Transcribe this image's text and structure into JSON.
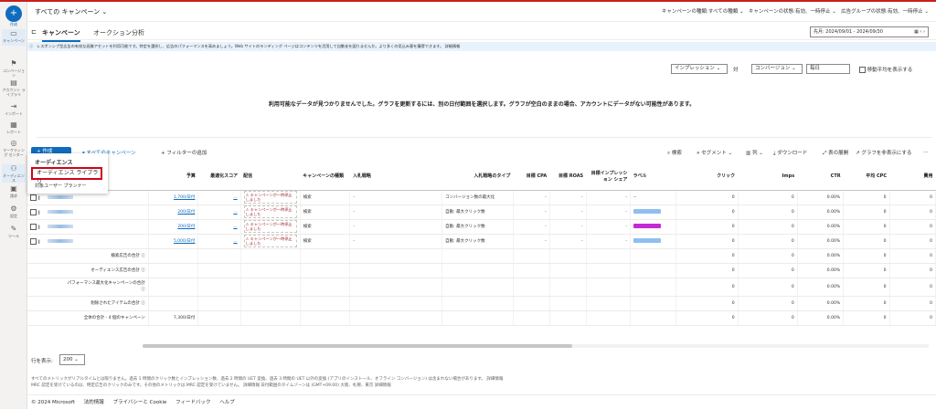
{
  "header": {
    "campaign_selector": "すべての キャンペーン",
    "filters": [
      "キャンペーンの種類:すべての種類",
      "キャンペーンの状態:有効、一時停止",
      "広告グループの状態:有効、一時停止"
    ]
  },
  "rail": {
    "create": "作成",
    "items": [
      "キャンペーン",
      "コンバージョン",
      "アカウント\nライブラリ",
      "インポート",
      "レポート",
      "マーケティング\nセンター",
      "オーディエンス",
      "請求",
      "設定",
      "ツール"
    ]
  },
  "tabs": {
    "items": [
      "キャンペーン",
      "オークション分析"
    ],
    "date_range": "先月: 2024/09/01 - 2024/09/30"
  },
  "info_banner": "レスポンシブ型広告の有効な画像アセットを利用可能です。特定を選択し、広告のパフォーマンスを高めましょう。Web サイトのランディング ページはコンテンツを活用して自動化を図りませんか。より多くの見込み客を獲得できます。  詳細情報",
  "chart_controls": {
    "metric1": "インプレッション",
    "vs": "対",
    "metric2": "コンバージョン",
    "period": "毎日",
    "moving_avg": "移動平均を表示する"
  },
  "no_data_msg": "利用可能なデータが見つかりませんでした。グラフを更新するには、別の日付範囲を選択します。グラフが空白のままの場合、アカウントにデータがない可能性があります。",
  "toolbar": {
    "add": "+ 作成",
    "all_campaigns": "すべてのキャンペーン",
    "add_filter": "+ フィルターの追加",
    "search": "検索",
    "segment": "セグメント",
    "columns": "列",
    "download": "ダウンロード",
    "expand": "表の展開",
    "hide_chart": "グラフを非表示にする"
  },
  "popup": {
    "heading": "オーディエンス",
    "library": "オーディエンス ライブラリ",
    "planner": "対象ユーザー プランナー"
  },
  "table": {
    "columns": [
      "予算",
      "最適化スコア",
      "配信",
      "キャンペーンの種類",
      "入札戦略",
      "入札戦略のタイプ",
      "目標 CPA",
      "目標 ROAS",
      "目標インプレッション シェア",
      "ラベル",
      "クリック",
      "Imps",
      "CTR",
      "平均 CPC",
      "費用"
    ],
    "rows": [
      {
        "budget": "1,700/日付",
        "score": "...",
        "delivery": "キャンペーンが一時停止しました",
        "type": "検索",
        "bid": "-",
        "bidtype": "コンバージョン数の最大化",
        "cpa": "-",
        "roas": "-",
        "share": "-",
        "label": "--",
        "clicks": "0",
        "imps": "0",
        "ctr": "0.00%",
        "cpc": "0",
        "cost": "0"
      },
      {
        "budget": "200/日付",
        "score": "...",
        "delivery": "キャンペーンが一時停止しました",
        "type": "検索",
        "bid": "-",
        "bidtype": "自動: 最大クリック数",
        "cpa": "-",
        "roas": "-",
        "share": "-",
        "label": "",
        "clicks": "0",
        "imps": "0",
        "ctr": "0.00%",
        "cpc": "0",
        "cost": "0"
      },
      {
        "budget": "200/日付",
        "score": "...",
        "delivery": "キャンペーンが一時停止しました",
        "type": "検索",
        "bid": "-",
        "bidtype": "自動: 最大クリック数",
        "cpa": "-",
        "roas": "-",
        "share": "-",
        "label": "",
        "clicks": "0",
        "imps": "0",
        "ctr": "0.00%",
        "cpc": "0",
        "cost": "0"
      },
      {
        "budget": "5,000/日付",
        "score": "...",
        "delivery": "キャンペーンが一時停止しました",
        "type": "検索",
        "bid": "-",
        "bidtype": "自動: 最大クリック数",
        "cpa": "-",
        "roas": "-",
        "share": "-",
        "label": "",
        "clicks": "0",
        "imps": "0",
        "ctr": "0.00%",
        "cpc": "0",
        "cost": "0"
      }
    ],
    "label_colors": [
      "#8fbfee",
      "#c42bd3",
      "#8fbfee"
    ],
    "totals": [
      {
        "label": "検索広告の合計",
        "budget": "",
        "clicks": "0",
        "imps": "0",
        "ctr": "0.00%",
        "cpc": "0",
        "cost": "0"
      },
      {
        "label": "オーディエンス広告の合計",
        "budget": "",
        "clicks": "0",
        "imps": "0",
        "ctr": "0.00%",
        "cpc": "0",
        "cost": "0"
      },
      {
        "label": "パフォーマンス最大化キャンペーンの合計",
        "budget": "",
        "clicks": "0",
        "imps": "0",
        "ctr": "0.00%",
        "cpc": "0",
        "cost": "0"
      },
      {
        "label": "削除されたアイテムの合計",
        "budget": "",
        "clicks": "0",
        "imps": "0",
        "ctr": "0.00%",
        "cpc": "0",
        "cost": "0"
      },
      {
        "label": "全体の合計 - 4 個のキャンペーン",
        "budget": "7,300/日付",
        "clicks": "0",
        "imps": "0",
        "ctr": "0.00%",
        "cpc": "0",
        "cost": "0"
      }
    ]
  },
  "pager": {
    "rows_label": "行を表示:",
    "rows_value": "200"
  },
  "footnote": "すべてのメトリックがリアルタイムとは限りません。過去 1 時間のクリック数とインプレッション数、過去 2 時間の UET 変換、過去 3 時間の UET 以外の変換 (アプリのインストール、オフライン コンバージョン) は含まれない場合があります。 詳細情報\nMRC 認定を受けているのは、特定広告のクリックのみです。その他のメトリックは MRC 認定を受けていません。 詳細情報   日付範囲のタイムゾーンは (GMT+09:00) 大阪、札幌、東京 詳細情報",
  "footer": [
    "© 2024 Microsoft",
    "法的情報",
    "プライバシーと Cookie",
    "フィードバック",
    "ヘルプ"
  ]
}
